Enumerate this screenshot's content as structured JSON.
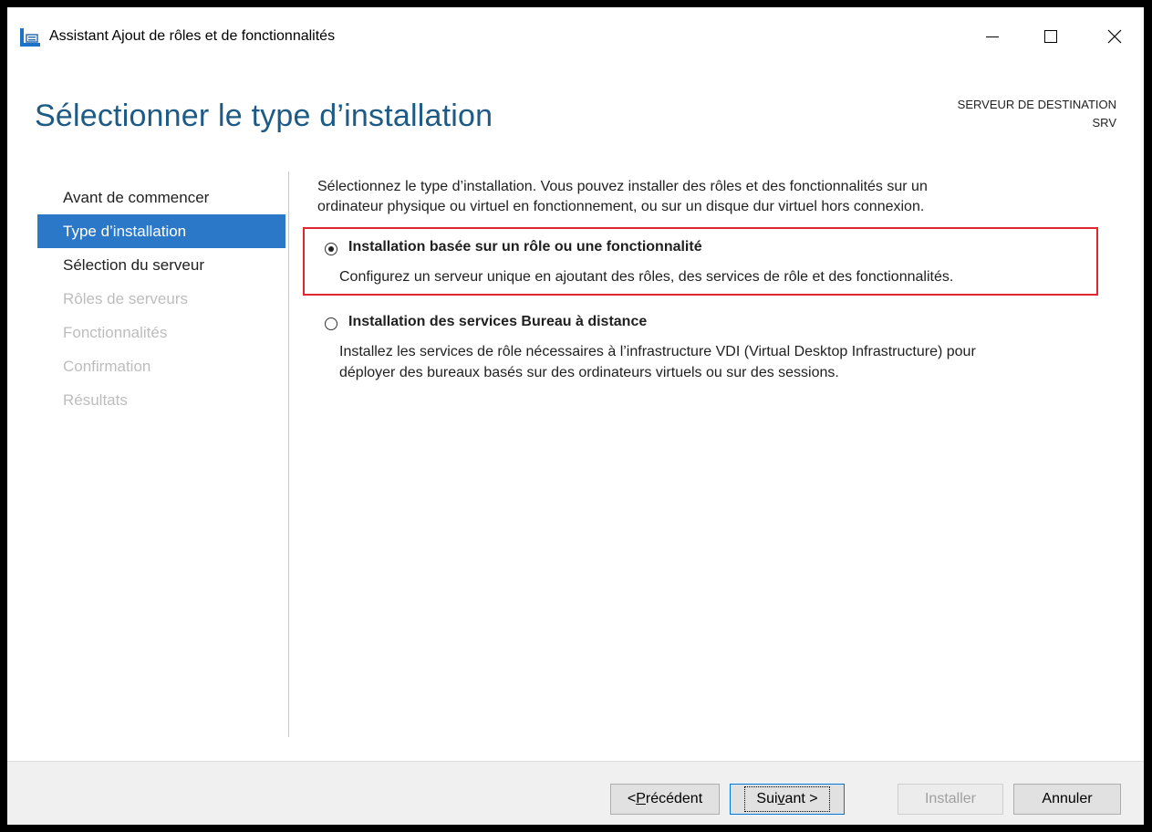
{
  "window": {
    "title": "Assistant Ajout de rôles et de fonctionnalités",
    "icon": "server-manager-icon",
    "controls": [
      "minimize-icon",
      "maximize-icon",
      "close-icon"
    ]
  },
  "header": {
    "heading": "Sélectionner le type d’installation",
    "destination_label": "SERVEUR DE DESTINATION",
    "destination_server": "SRV"
  },
  "nav": {
    "items": [
      {
        "label": "Avant de commencer",
        "state": "normal"
      },
      {
        "label": "Type d’installation",
        "state": "active"
      },
      {
        "label": "Sélection du serveur",
        "state": "normal"
      },
      {
        "label": "Rôles de serveurs",
        "state": "disabled"
      },
      {
        "label": "Fonctionnalités",
        "state": "disabled"
      },
      {
        "label": "Confirmation",
        "state": "disabled"
      },
      {
        "label": "Résultats",
        "state": "disabled"
      }
    ]
  },
  "content": {
    "intro_line1": "Sélectionnez le type d’installation. Vous pouvez installer des rôles et des fonctionnalités sur un",
    "intro_line2": "ordinateur physique ou virtuel en fonctionnement, ou sur un disque dur virtuel hors connexion.",
    "options": [
      {
        "title": "Installation basée sur un rôle ou une fonctionnalité",
        "description": "Configurez un serveur unique en ajoutant des rôles, des services de rôle et des fonctionnalités.",
        "selected": true
      },
      {
        "title": "Installation des services Bureau à distance",
        "description_line1": "Installez les services de rôle nécessaires à l’infrastructure VDI (Virtual Desktop Infrastructure) pour",
        "description_line2": "déployer des bureaux basés sur des ordinateurs virtuels ou sur des sessions.",
        "selected": false
      }
    ]
  },
  "footer": {
    "prev_prefix": "< ",
    "prev_mnemonic": "P",
    "prev_rest": "récédent",
    "next_prefix": "Sui",
    "next_mnemonic": "v",
    "next_rest": "ant >",
    "install_label": "Installer",
    "cancel_label": "Annuler"
  },
  "colors": {
    "heading": "#1d5a86",
    "nav_active_bg": "#2b78c8",
    "highlight_box": "#e0262d"
  }
}
